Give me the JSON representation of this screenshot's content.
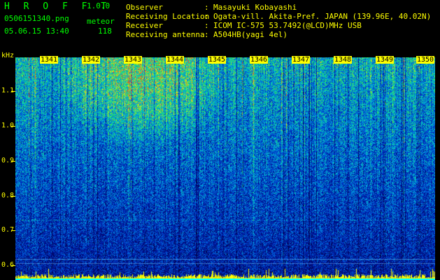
{
  "header": {
    "app_name": "H R O F F T",
    "version": "1.0.0",
    "filename": "0506151340.png",
    "datetime": "05.06.15 13:40",
    "meteor_label": "meteor",
    "meteor_count": "118",
    "fields": [
      {
        "label": "Observer",
        "value": "Masayuki Kobayashi"
      },
      {
        "label": "Receiving Location",
        "value": "Ogata-vill. Akita-Pref. JAPAN (139.96E, 40.02N)"
      },
      {
        "label": "Receiver",
        "value": "ICOM IC-575 53.7492(@LCD)MHz USB"
      },
      {
        "label": "Receiving antenna",
        "value": "A504HB(yagi 4el)"
      }
    ]
  },
  "plot": {
    "y_unit": "kHz",
    "y_ticks": [
      "1.1",
      "1.0",
      "0.9",
      "0.8",
      "0.7",
      "0.6"
    ],
    "x_ticks": [
      "1341",
      "1342",
      "1343",
      "1344",
      "1345",
      "1346",
      "1347",
      "1348",
      "1349",
      "1350"
    ]
  }
}
